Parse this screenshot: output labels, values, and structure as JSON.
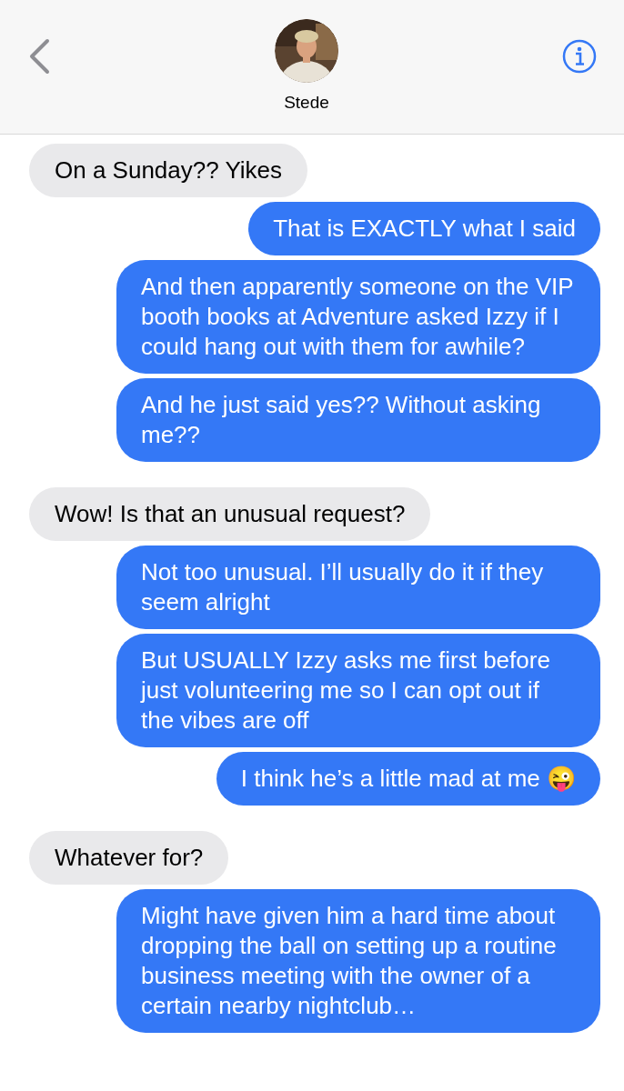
{
  "header": {
    "contact_name": "Stede"
  },
  "groups": [
    {
      "messages": [
        {
          "kind": "incoming",
          "text": "On a Sunday?? Yikes"
        },
        {
          "kind": "outgoing",
          "text": "That is EXACTLY what I said"
        },
        {
          "kind": "outgoing",
          "text": "And then apparently someone on the VIP booth books at Adventure asked Izzy if I could hang out with them for awhile?"
        },
        {
          "kind": "outgoing",
          "text": "And he just said yes?? Without asking me??"
        }
      ]
    },
    {
      "messages": [
        {
          "kind": "incoming",
          "text": "Wow! Is that an unusual request?"
        },
        {
          "kind": "outgoing",
          "text": "Not too unusual. I’ll usually do it if they seem alright"
        },
        {
          "kind": "outgoing",
          "text": "But USUALLY Izzy asks me first before just volunteering me so I can opt out if the vibes are off"
        },
        {
          "kind": "outgoing",
          "text": "I think he’s a little mad at me 😜"
        }
      ]
    },
    {
      "messages": [
        {
          "kind": "incoming",
          "text": "Whatever for?"
        },
        {
          "kind": "outgoing",
          "text": "Might have given him a hard time about dropping the ball on setting up a routine business meeting with the owner of a certain nearby nightclub…"
        }
      ]
    }
  ]
}
